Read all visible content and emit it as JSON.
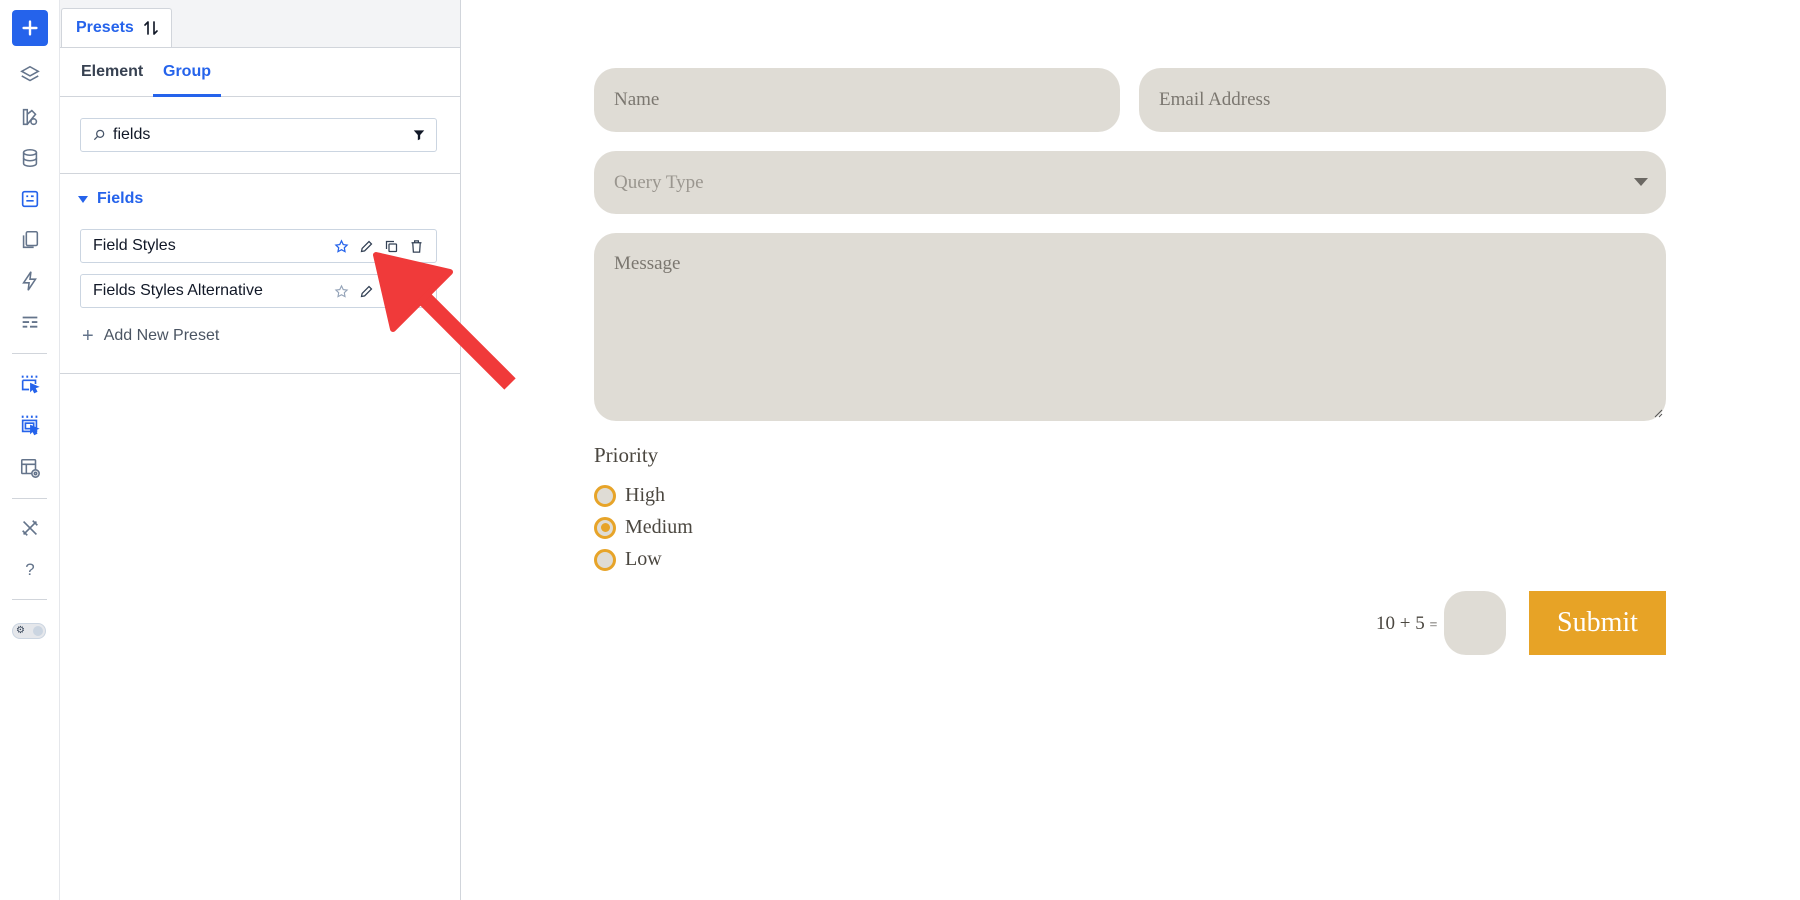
{
  "rail": {
    "icons": [
      "plus-icon",
      "layers-icon",
      "palette-icon",
      "database-icon",
      "form-icon",
      "pages-icon",
      "lightning-icon",
      "template-icon",
      "select-parent-icon",
      "select-child-icon",
      "layout-preview-icon",
      "tools-icon",
      "help-icon",
      "theme-toggle-icon"
    ],
    "help_label": "?",
    "accent": "#2563eb"
  },
  "panel": {
    "tab_label": "Presets",
    "subtabs": [
      {
        "label": "Element",
        "active": false
      },
      {
        "label": "Group",
        "active": true
      }
    ],
    "search": {
      "value": "fields",
      "placeholder": ""
    },
    "group": {
      "label": "Fields",
      "expanded": true
    },
    "presets": [
      {
        "name": "Field Styles",
        "favorited": false,
        "actions": [
          "star-icon",
          "edit-icon",
          "duplicate-icon",
          "delete-icon"
        ]
      },
      {
        "name": "Fields Styles Alternative",
        "favorited": false,
        "actions": [
          "star-icon",
          "edit-icon",
          "duplicate-icon",
          "delete-icon"
        ]
      }
    ],
    "add_label": "Add New Preset"
  },
  "form": {
    "name_placeholder": "Name",
    "email_placeholder": "Email Address",
    "query_placeholder": "Query Type",
    "message_placeholder": "Message",
    "priority_label": "Priority",
    "priority_options": [
      {
        "label": "High",
        "selected": false
      },
      {
        "label": "Medium",
        "selected": true
      },
      {
        "label": "Low",
        "selected": false
      }
    ],
    "captcha_question": "10 + 5",
    "captcha_equals": "=",
    "captcha_value": "",
    "submit_label": "Submit",
    "field_color": "#dfdcd5",
    "accent_color": "#e7a326"
  },
  "annotation": {
    "arrow_color": "#f03a3a",
    "points_to": "edit-icon"
  }
}
